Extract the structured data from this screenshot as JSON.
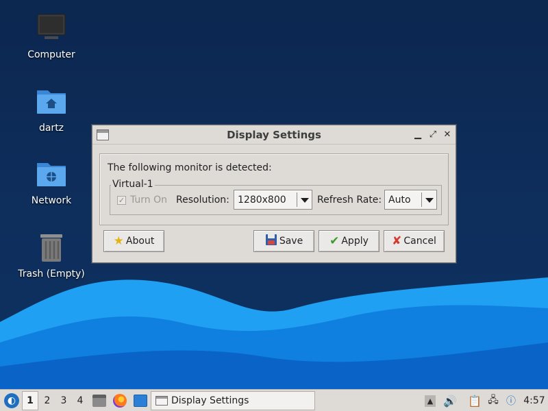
{
  "desktop": {
    "icons": [
      {
        "label": "Computer",
        "icon": "computer-icon"
      },
      {
        "label": "dartz",
        "icon": "home-folder-icon"
      },
      {
        "label": "Network",
        "icon": "network-folder-icon"
      },
      {
        "label": "Trash (Empty)",
        "icon": "trash-icon"
      }
    ]
  },
  "window": {
    "title": "Display Settings",
    "detected_text": "The following monitor is detected:",
    "monitor": {
      "name": "Virtual-1",
      "turn_on_label": "Turn On",
      "turn_on_checked": true,
      "turn_on_enabled": false,
      "resolution_label": "Resolution:",
      "resolution_value": "1280x800",
      "refresh_label": "Refresh Rate:",
      "refresh_value": "Auto"
    },
    "buttons": {
      "about": "About",
      "save": "Save",
      "apply": "Apply",
      "cancel": "Cancel"
    }
  },
  "taskbar": {
    "workspaces": [
      "1",
      "2",
      "3",
      "4"
    ],
    "active_workspace": "1",
    "task_label": "Display Settings",
    "clock": "4:57"
  },
  "colors": {
    "desktop_bg": "#0c2750",
    "wave_light": "#1e9bf0",
    "wave_dark": "#0b5fc4",
    "window_bg": "#dedbd7"
  }
}
